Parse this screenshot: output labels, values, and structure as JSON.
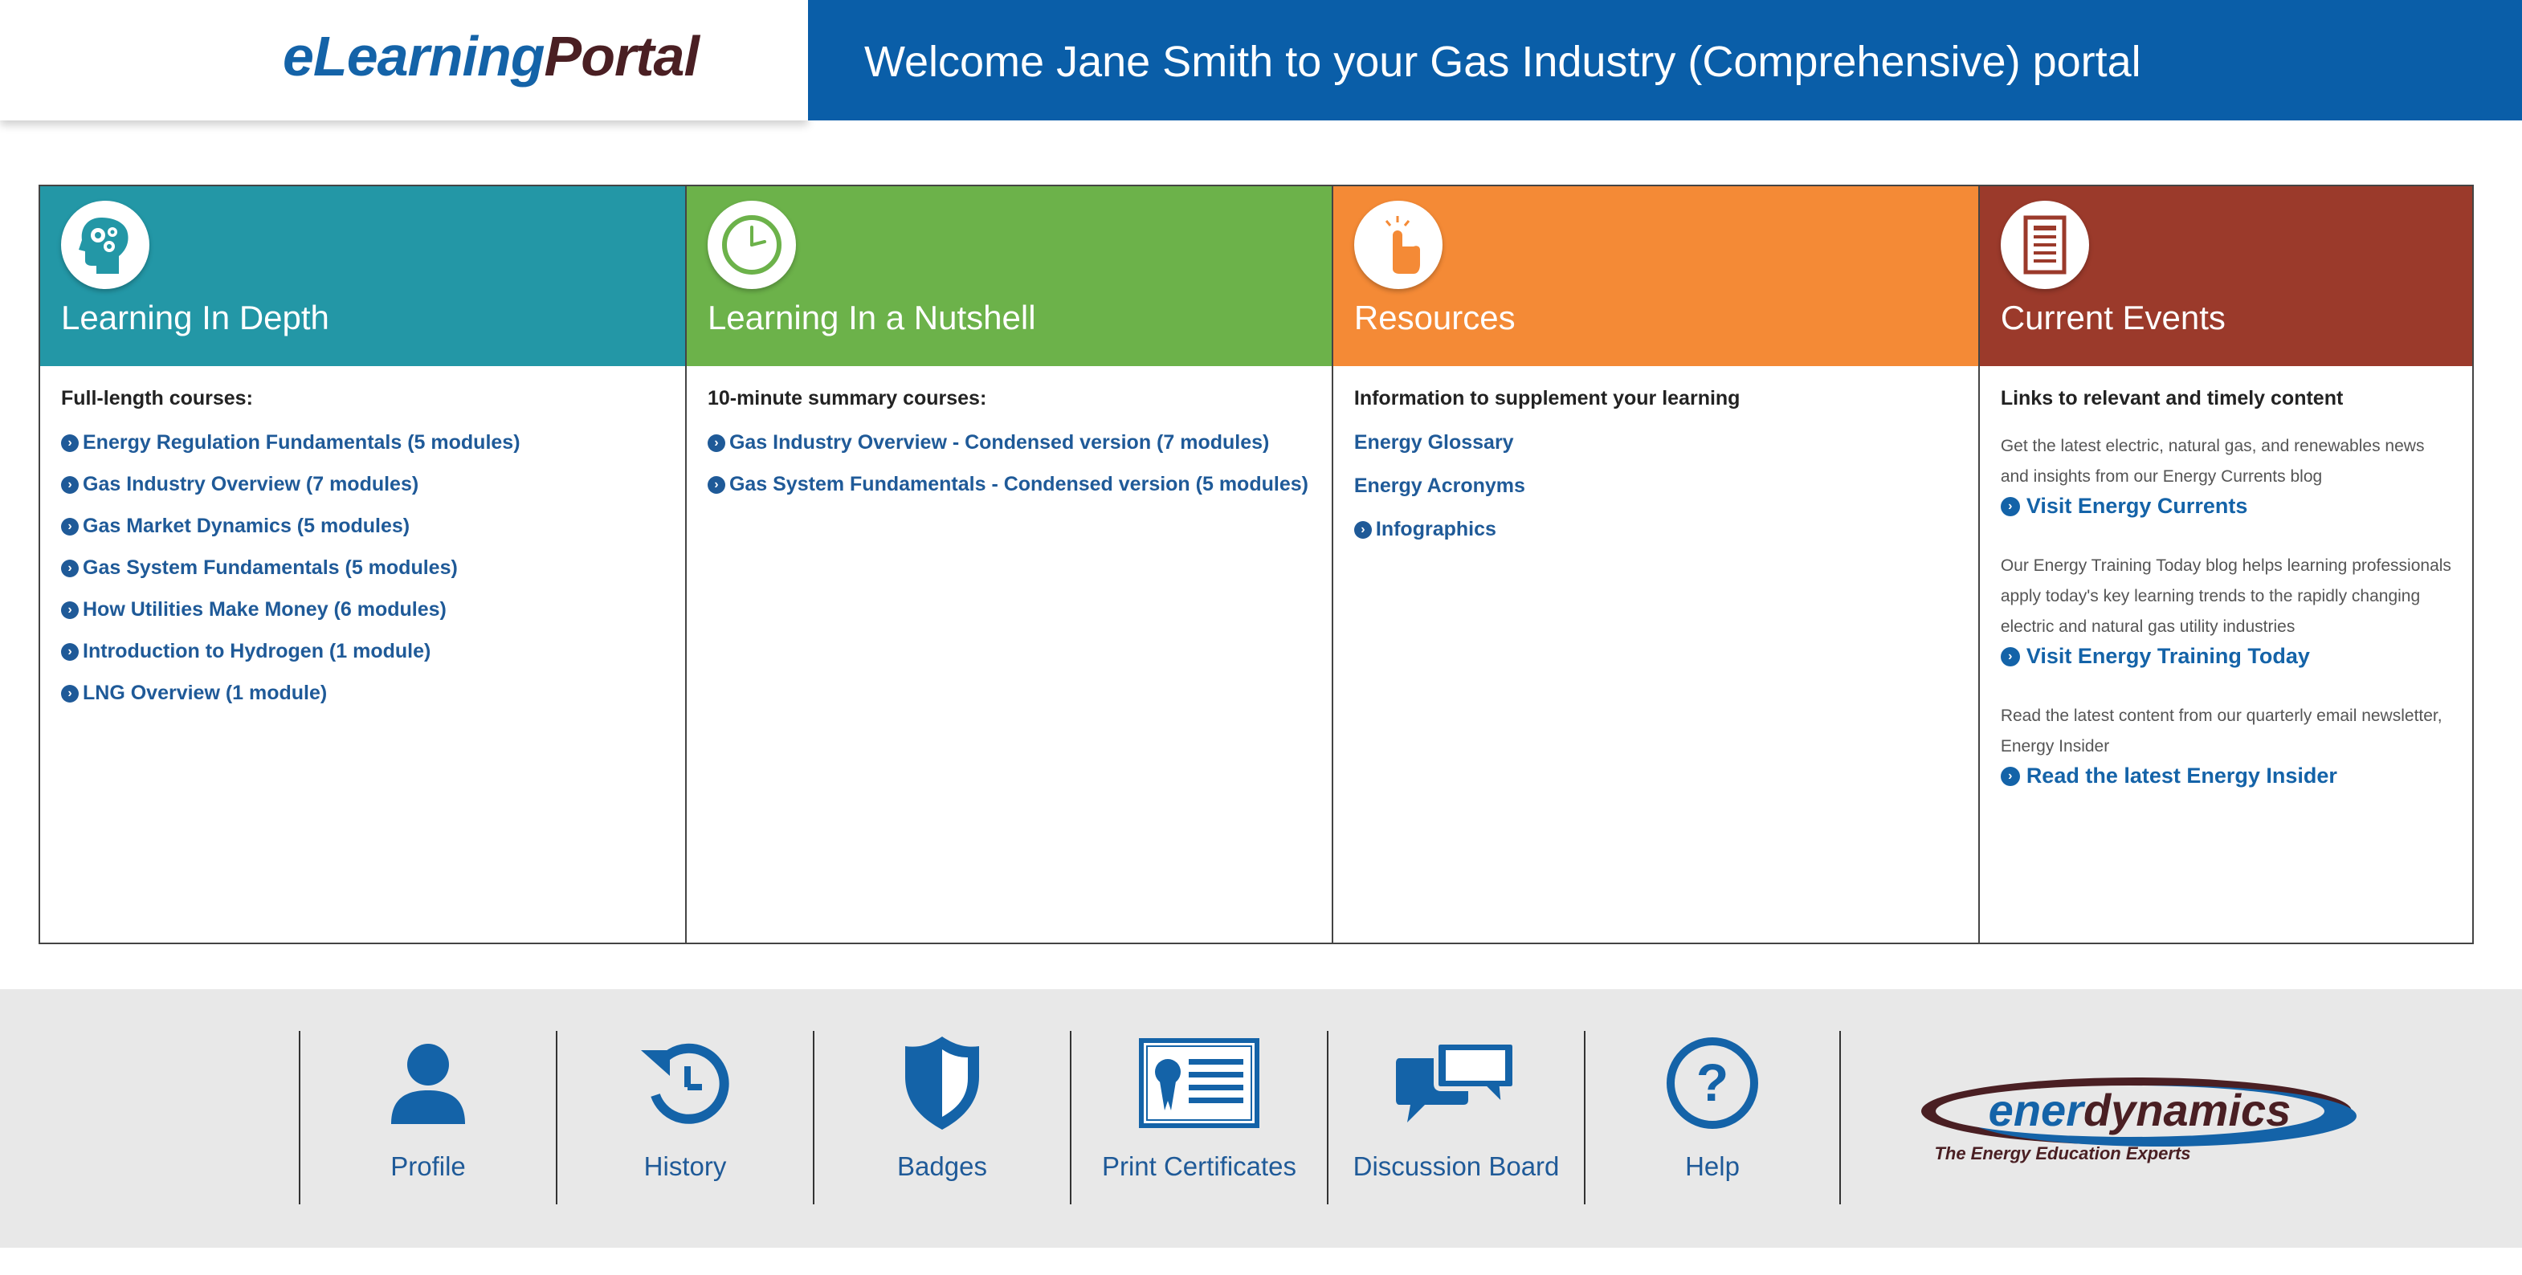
{
  "header": {
    "logo_part1": "eLearning",
    "logo_part2": "Portal",
    "welcome": "Welcome Jane Smith to your Gas Industry (Comprehensive) portal"
  },
  "colors": {
    "brand_blue": "#0a5ea8",
    "panel_teal": "#2397a6",
    "panel_green": "#6cb24a",
    "panel_orange": "#f48a36",
    "panel_red": "#9b3a2b",
    "link_blue": "#1f5a98"
  },
  "panels": [
    {
      "title": "Learning In Depth",
      "icon": "gears-head-icon",
      "subtitle": "Full-length courses:",
      "links": [
        "Energy Regulation Fundamentals (5 modules)",
        "Gas Industry Overview (7 modules)",
        "Gas Market Dynamics (5 modules)",
        "Gas System Fundamentals (5 modules)",
        "How Utilities Make Money (6 modules)",
        "Introduction to Hydrogen (1 module)",
        "LNG Overview (1 module)"
      ]
    },
    {
      "title": "Learning In a Nutshell",
      "icon": "clock-icon",
      "subtitle": "10-minute summary courses:",
      "links": [
        "Gas Industry Overview - Condensed version (7 modules)",
        "Gas System Fundamentals - Condensed version (5 modules)"
      ]
    },
    {
      "title": "Resources",
      "icon": "pointer-hand-icon",
      "subtitle": "Information to supplement your learning",
      "plain_links": [
        "Energy Glossary",
        "Energy Acronyms"
      ],
      "links": [
        "Infographics"
      ]
    },
    {
      "title": "Current Events",
      "icon": "newspaper-icon",
      "subtitle": "Links to relevant and timely content",
      "events": [
        {
          "text": "Get the latest electric, natural gas, and renewables news and insights from our Energy Currents blog",
          "link": "Visit Energy Currents"
        },
        {
          "text": "Our Energy Training Today blog helps learning professionals apply today's key learning trends to the rapidly changing electric and natural gas utility industries",
          "link": "Visit Energy Training Today"
        },
        {
          "text": "Read the latest content from our quarterly email newsletter, Energy Insider",
          "link": "Read the latest Energy Insider"
        }
      ]
    }
  ],
  "footer": {
    "nav": [
      {
        "label": "Profile",
        "icon": "person-icon"
      },
      {
        "label": "History",
        "icon": "history-icon"
      },
      {
        "label": "Badges",
        "icon": "shield-icon"
      },
      {
        "label": "Print Certificates",
        "icon": "certificate-icon"
      },
      {
        "label": "Discussion Board",
        "icon": "chat-bubbles-icon"
      },
      {
        "label": "Help",
        "icon": "question-icon"
      }
    ],
    "brand_name": "enerdynamics",
    "brand_tagline": "The Energy Education Experts"
  }
}
